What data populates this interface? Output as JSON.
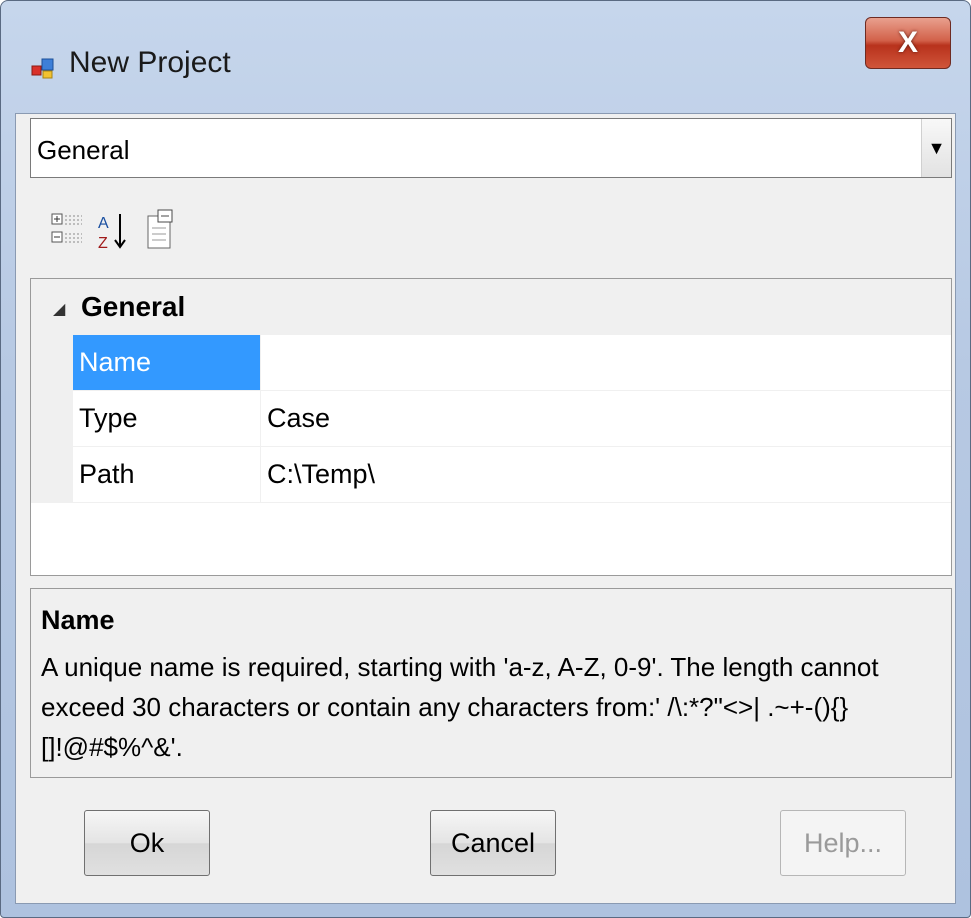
{
  "window": {
    "title": "New Project",
    "close_label": "X",
    "accent_color": "#3399ff"
  },
  "category_combo": {
    "selected": "General",
    "dropdown_icon": "chevron-down-icon"
  },
  "toolbar": {
    "buttons": [
      {
        "name": "categorized-view",
        "icon": "categorized-icon"
      },
      {
        "name": "alphabetical-sort",
        "icon": "sort-az-icon"
      },
      {
        "name": "property-pages",
        "icon": "property-pages-icon"
      }
    ]
  },
  "property_grid": {
    "category": "General",
    "rows": [
      {
        "name": "Name",
        "value": "",
        "selected": true
      },
      {
        "name": "Type",
        "value": "Case",
        "selected": false
      },
      {
        "name": "Path",
        "value": "C:\\Temp\\",
        "selected": false
      }
    ]
  },
  "description": {
    "title": "Name",
    "text": "A unique name is required, starting with 'a-z, A-Z, 0-9'. The length cannot exceed 30 characters or contain any characters from:' /\\:*?\"<>| .~+-(){}[]!@#$%^&'."
  },
  "buttons": {
    "ok": "Ok",
    "cancel": "Cancel",
    "help": "Help..."
  }
}
